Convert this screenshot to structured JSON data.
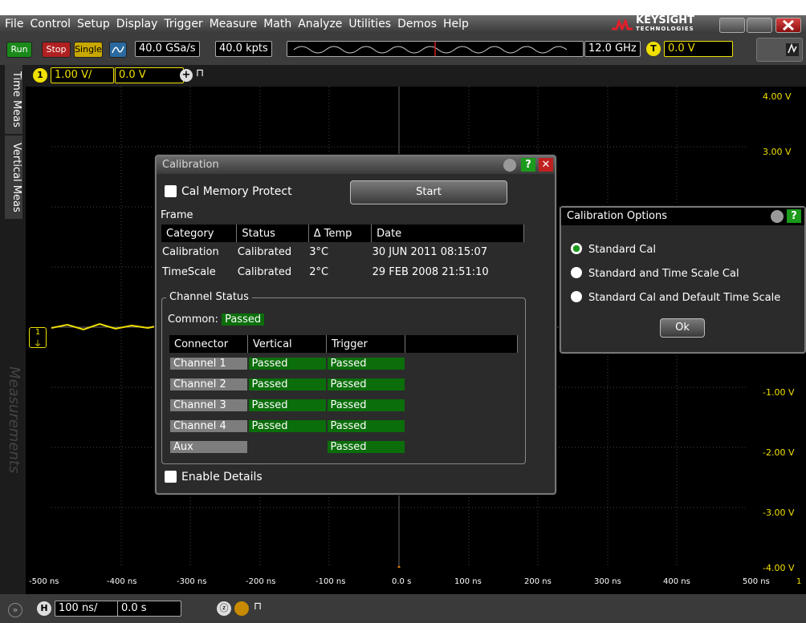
{
  "menu": [
    "File",
    "Control",
    "Setup",
    "Display",
    "Trigger",
    "Measure",
    "Math",
    "Analyze",
    "Utilities",
    "Demos",
    "Help"
  ],
  "brand": {
    "name": "KEYSIGHT",
    "sub": "TECHNOLOGIES"
  },
  "toolbar": {
    "run": "Run",
    "stop": "Stop",
    "single": "Single",
    "sample_rate": "40.0 GSa/s",
    "memory": "40.0 kpts",
    "bandwidth": "12.0 GHz",
    "trigger_badge": "T",
    "trigger_level": "0.0 V"
  },
  "channel": {
    "badge": "1",
    "scale": "1.00 V/",
    "offset": "0.0 V"
  },
  "side_tabs": {
    "time_meas": "Time Meas",
    "vertical_meas": "Vertical Meas",
    "measurements": "Measurements"
  },
  "scope": {
    "v_labels": [
      "4.00 V",
      "3.00 V",
      "-1.00 V",
      "-2.00 V",
      "-3.00 V",
      "-4.00 V"
    ],
    "h_labels": [
      "-500 ns",
      "-400 ns",
      "-300 ns",
      "-200 ns",
      "-100 ns",
      "0.0 s",
      "100 ns",
      "200 ns",
      "300 ns",
      "400 ns",
      "500 ns"
    ],
    "channel_number": "1"
  },
  "horizontal": {
    "badge": "H",
    "scale": "100 ns/",
    "position": "0.0 s"
  },
  "calibration": {
    "title": "Calibration",
    "cal_memory_protect": "Cal Memory Protect",
    "start": "Start",
    "frame_label": "Frame",
    "frame_headers": [
      "Category",
      "Status",
      "Δ Temp",
      "Date"
    ],
    "frame_rows": [
      [
        "Calibration",
        "Calibrated",
        "3°C",
        "30 JUN 2011 08:15:07"
      ],
      [
        "TimeScale",
        "Calibrated",
        "2°C",
        "29 FEB 2008 21:51:10"
      ]
    ],
    "channel_status_label": "Channel Status",
    "common_label": "Common:",
    "common_value": "Passed",
    "channel_headers": [
      "Connector",
      "Vertical",
      "Trigger"
    ],
    "channel_rows": [
      [
        "Channel 1",
        "Passed",
        "Passed"
      ],
      [
        "Channel 2",
        "Passed",
        "Passed"
      ],
      [
        "Channel 3",
        "Passed",
        "Passed"
      ],
      [
        "Channel 4",
        "Passed",
        "Passed"
      ],
      [
        "Aux",
        "",
        "Passed"
      ]
    ],
    "enable_details": "Enable Details"
  },
  "cal_options": {
    "title": "Calibration Options",
    "options": [
      "Standard Cal",
      "Standard and Time Scale Cal",
      "Standard Cal and Default Time Scale"
    ],
    "selected": 0,
    "ok": "Ok"
  },
  "colors": {
    "channel1": "#f0e000",
    "passed": "#0b6e0b",
    "connector": "#7d7d7d",
    "close": "#c02020"
  },
  "icons": [
    "help-icon",
    "gear-icon",
    "close-icon",
    "checkbox-icon",
    "radio-icon"
  ]
}
